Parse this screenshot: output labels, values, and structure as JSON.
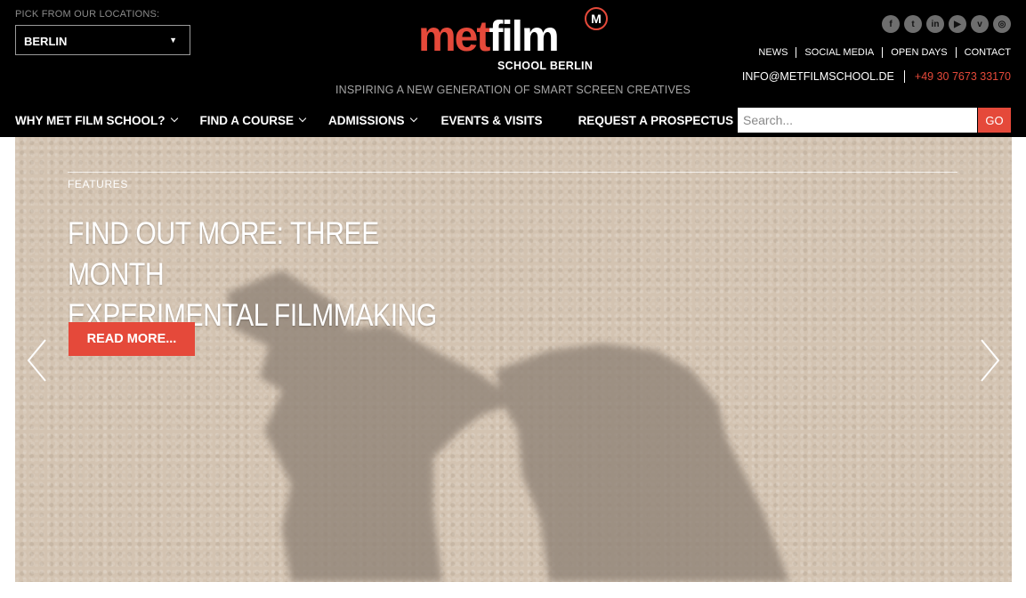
{
  "location": {
    "label": "PICK FROM OUR LOCATIONS:",
    "selected": "BERLIN"
  },
  "logo": {
    "word_met": "met",
    "word_film": "film",
    "badge": "M",
    "subtitle": "SCHOOL BERLIN"
  },
  "tagline": "INSPIRING A NEW GENERATION OF SMART SCREEN CREATIVES",
  "social": [
    {
      "icon": "facebook-icon",
      "glyph": "f"
    },
    {
      "icon": "twitter-icon",
      "glyph": "t"
    },
    {
      "icon": "linkedin-icon",
      "glyph": "in"
    },
    {
      "icon": "youtube-icon",
      "glyph": "▶"
    },
    {
      "icon": "vimeo-icon",
      "glyph": "v"
    },
    {
      "icon": "instagram-icon",
      "glyph": "◎"
    }
  ],
  "toplinks": [
    "NEWS",
    "SOCIAL MEDIA",
    "OPEN DAYS",
    "CONTACT"
  ],
  "contact": {
    "email": "INFO@METFILMSCHOOL.DE",
    "phone": "+49 30 7673 33170"
  },
  "nav": [
    {
      "label": "WHY MET FILM SCHOOL?",
      "dropdown": true
    },
    {
      "label": "FIND A COURSE",
      "dropdown": true
    },
    {
      "label": "ADMISSIONS",
      "dropdown": true
    },
    {
      "label": "EVENTS & VISITS",
      "dropdown": false
    },
    {
      "label": "REQUEST A PROSPECTUS",
      "dropdown": false
    }
  ],
  "search": {
    "placeholder": "Search...",
    "button": "GO"
  },
  "hero": {
    "kicker": "FEATURES",
    "title_line1": "FIND OUT MORE: THREE MONTH",
    "title_line2": "EXPERIMENTAL FILMMAKING",
    "button": "READ MORE..."
  },
  "colors": {
    "accent": "#e5493a",
    "header_bg": "#000000",
    "wall": "#d3c3b1"
  }
}
